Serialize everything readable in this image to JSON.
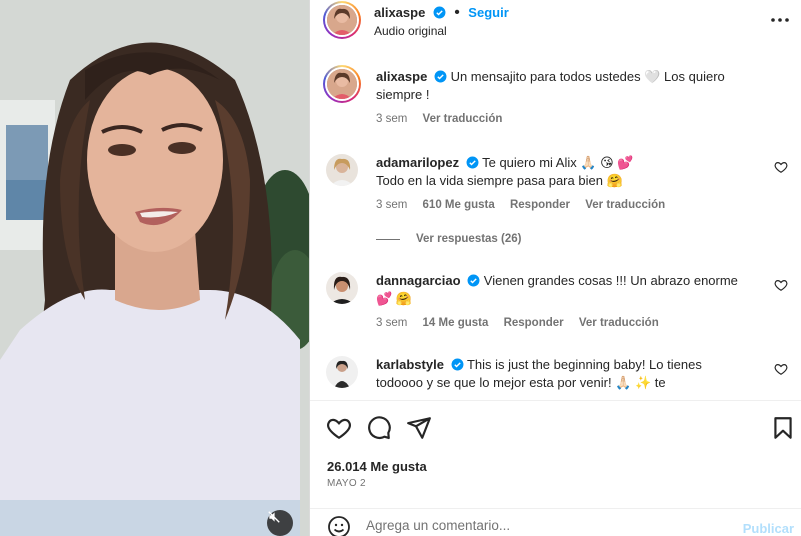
{
  "post": {
    "author": "alixaspe",
    "follow_label": "Seguir",
    "audio": "Audio original",
    "more_icon": "more-horizontal-icon"
  },
  "caption": {
    "author": "alixaspe",
    "text": "Un mensajito para todos ustedes 🤍 Los quiero siempre !",
    "time": "3 sem",
    "translate": "Ver traducción"
  },
  "comments": [
    {
      "author": "adamarilopez",
      "text_line1": "Te quiero mi Alix 🙏🏻 😘 💕",
      "text_line2": "Todo en la vida siempre pasa para bien 🤗",
      "time": "3 sem",
      "likes": "610 Me gusta",
      "reply": "Responder",
      "translate": "Ver traducción",
      "view_replies": "Ver respuestas (26)"
    },
    {
      "author": "dannagarciao",
      "text_line1": "Vienen grandes cosas !!! Un abrazo enorme",
      "text_line2": "💕 🤗",
      "time": "3 sem",
      "likes": "14 Me gusta",
      "reply": "Responder",
      "translate": "Ver traducción"
    },
    {
      "author": "karlabstyle",
      "text_line1": "This is just the beginning baby! Lo tienes",
      "text_line2": "todoooo y se que lo mejor esta por venir! 🙏🏻 ✨ te"
    }
  ],
  "footer": {
    "likes": "26.014 Me gusta",
    "date": "MAYO 2",
    "comment_placeholder": "Agrega un comentario...",
    "post_label": "Publicar"
  },
  "colors": {
    "accent": "#0095f6",
    "verified": "#0095f6",
    "muted": "#737373",
    "post_disabled": "#b2dffc"
  }
}
